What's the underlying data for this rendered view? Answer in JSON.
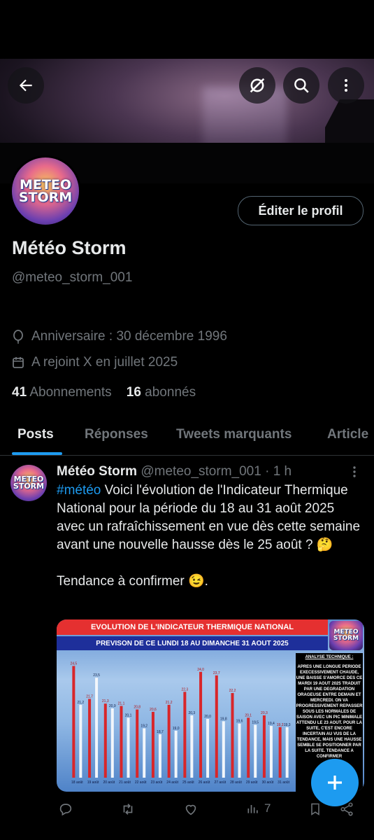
{
  "profile": {
    "name": "Météo Storm",
    "handle": "@meteo_storm_001",
    "edit_label": "Éditer le profil",
    "birthday": "Anniversaire : 30 décembre 1996",
    "joined": "A rejoint X en juillet 2025",
    "following_count": "41",
    "following_label": "Abonnements",
    "followers_count": "16",
    "followers_label": "abonnés",
    "logo_text_line1": "METEO",
    "logo_text_line2": "STORM"
  },
  "tabs": [
    "Posts",
    "Réponses",
    "Tweets marquants",
    "Article"
  ],
  "post": {
    "author": "Météo Storm",
    "handle": "@meteo_storm_001",
    "time": "1 h",
    "hashtag": "#météo",
    "text": " Voici l'évolution de l'Indicateur Thermique National pour la période du 18 au 31 août 2025 avec un rafraîchissement en vue dès cette semaine avant une nouvelle hausse dès le 25 août ? 🤔",
    "text2": "Tendance à confirmer 😉.",
    "views": "7"
  },
  "media": {
    "title": "EVOLUTION DE L'INDICATEUR THERMIQUE NATIONAL",
    "subtitle": "PREVISON DE CE LUNDI 18 AU DIMANCHE 31 AOUT 2025",
    "analysis_heading": "ANALYSE TECHNIQUE :",
    "analysis_text": "APRES UNE LONGUE PERIODE EXECESSIVEMENT CHAUDE, UNE BAISSE S'AMORCE DES CE MARDI 19 AOUT 2025 TRADUIT PAR UNE DEGRADATION ORAGEUSE ENTRE DEMAIN ET MERCREDI. ON VA PROGRESSIVEMENT REPASSER SOUS LES NORMALES DE SAISON AVEC UN PIC MINIMALE ATTENDU LE 23 AOUT. POUR LA SUITE, C'EST ENCORE INCERTAIN AU VUS DE LA TENDANCE, MAIS UNE HAUSSE SEMBLE SE POSITIONNER PAR LA SUITE. TENDANCE A CONFIRMER"
  },
  "chart_data": {
    "type": "bar",
    "categories": [
      "18 août",
      "19 août",
      "20 août",
      "21 août",
      "22 août",
      "23 août",
      "24 août",
      "25 août",
      "26 août",
      "27 août",
      "28 août",
      "29 août",
      "30 août",
      "31 août"
    ],
    "series": [
      {
        "values": [
          24.5,
          21.7,
          21.3,
          21.1,
          20.8,
          20.6,
          21.2,
          22.3,
          24.0,
          23.7,
          22.2,
          20.1,
          20.3,
          19.3
        ]
      },
      {
        "values": [
          21.2,
          23.5,
          20.9,
          20.1,
          19.2,
          18.7,
          19.0,
          20.3,
          20.0,
          19.8,
          19.6,
          19.5,
          19.4,
          19.3
        ]
      }
    ],
    "colors": [
      "#d8262a",
      "#f2f6fb"
    ]
  }
}
